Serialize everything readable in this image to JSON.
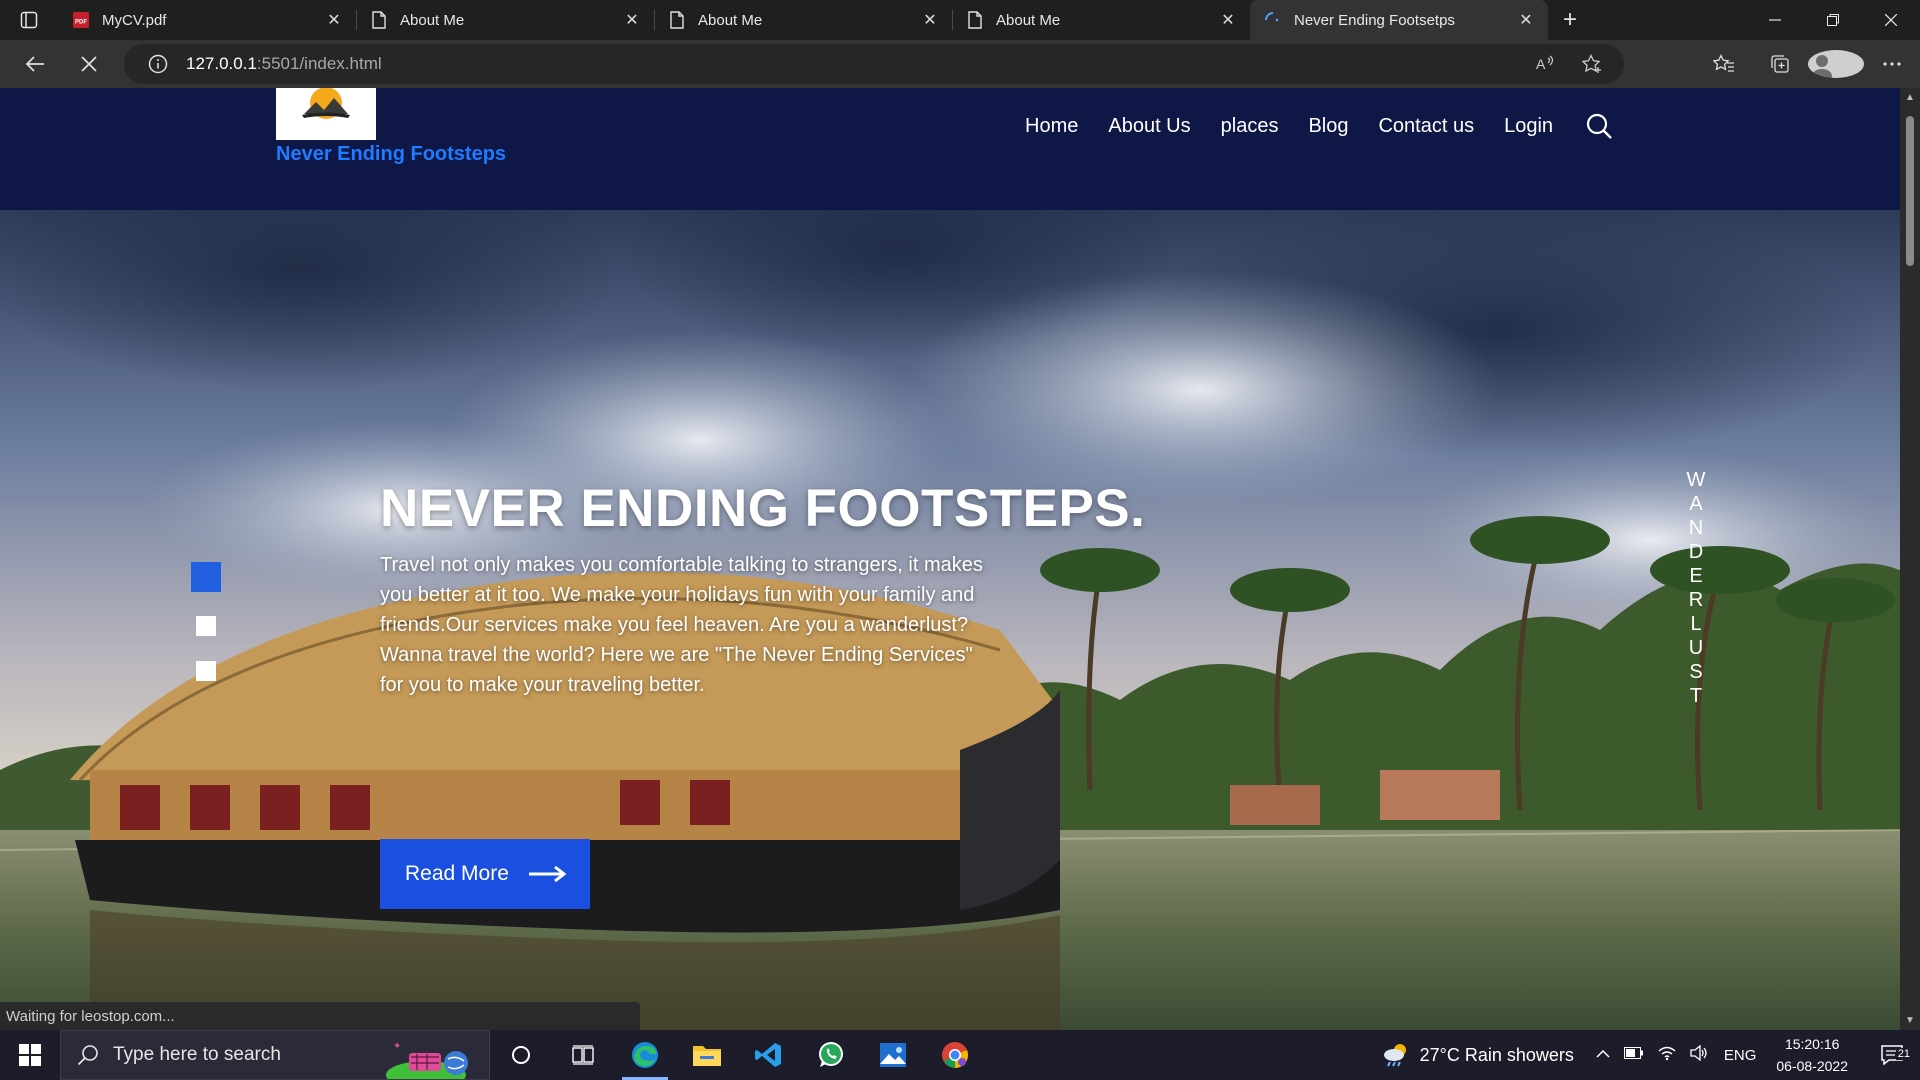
{
  "browser": {
    "tabs": [
      {
        "title": "MyCV.pdf",
        "icon": "pdf-icon"
      },
      {
        "title": "About Me",
        "icon": "page-icon"
      },
      {
        "title": "About Me",
        "icon": "page-icon"
      },
      {
        "title": "About Me",
        "icon": "page-icon"
      },
      {
        "title": "Never Ending Footsetps",
        "icon": "loading-icon",
        "active": true
      }
    ],
    "url_host": "127.0.0.1",
    "url_path": ":5501/index.html",
    "status_text": "Waiting for leostop.com..."
  },
  "site": {
    "name": "Never Ending Footsteps",
    "nav": [
      "Home",
      "About Us",
      "places",
      "Blog",
      "Contact us",
      "Login"
    ],
    "hero_title": "NEVER ENDING FOOTSTEPS.",
    "hero_text": "Travel not only makes you comfortable talking to strangers, it makes you better at it too. We make your holidays fun with your family and friends.Our services make you feel heaven. Are you a wanderlust? Wanna travel the world? Here we are \"The Never Ending Services\" for you to make your traveling better.",
    "read_more": "Read More",
    "vertical_word": [
      "W",
      "A",
      "N",
      "D",
      "E",
      "R",
      "L",
      "U",
      "S",
      "T"
    ]
  },
  "taskbar": {
    "search_placeholder": "Type here to search",
    "weather": "27°C  Rain showers",
    "lang": "ENG",
    "time": "15:20:16",
    "date": "06-08-2022",
    "notifications": "21"
  },
  "colors": {
    "header_bg": "#0f1746",
    "site_name": "#1f7bff",
    "button": "#1a4fe0"
  }
}
